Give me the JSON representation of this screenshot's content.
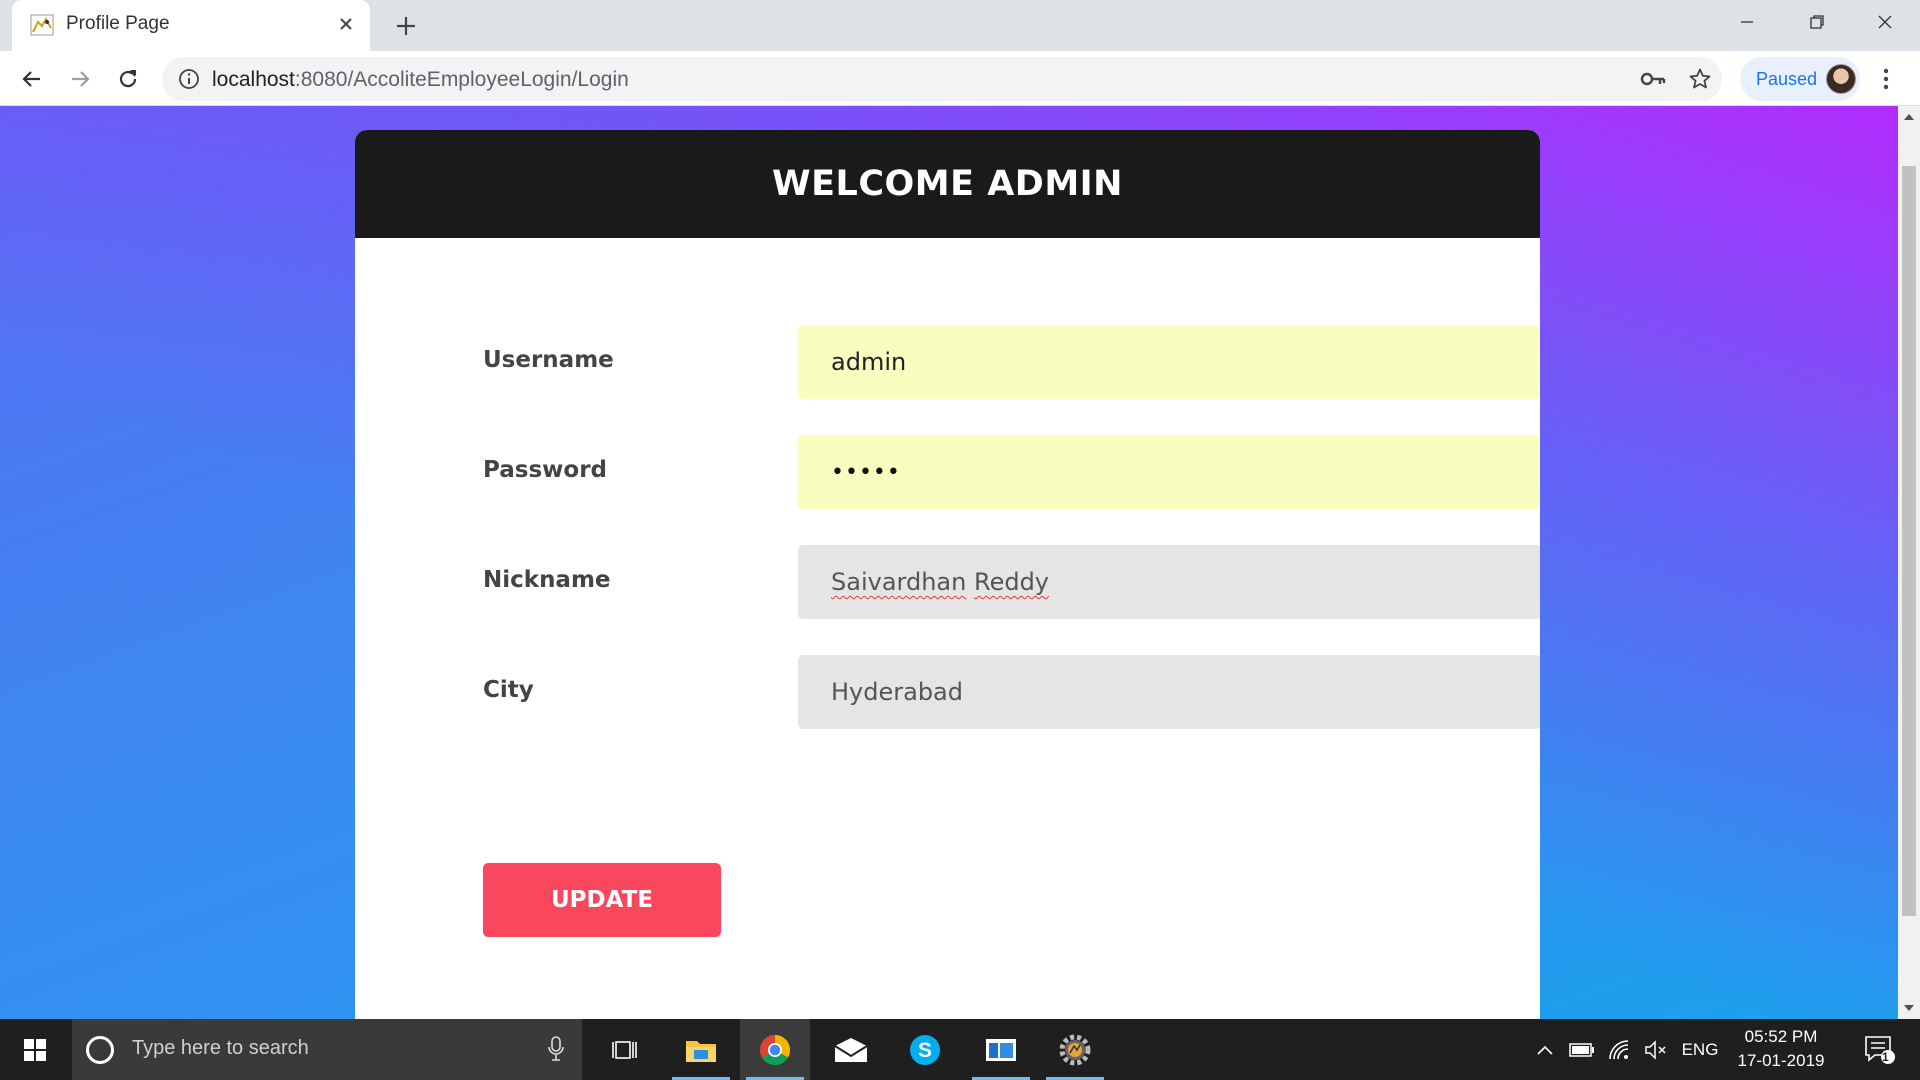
{
  "browser": {
    "tab_title": "Profile Page",
    "url_host": "localhost",
    "url_path": ":8080/AccoliteEmployeeLogin/Login",
    "profile_label": "Paused"
  },
  "page": {
    "title": "WELCOME ADMIN",
    "fields": {
      "username": {
        "label": "Username",
        "value": "admin"
      },
      "password": {
        "label": "Password",
        "value": "•••••"
      },
      "nickname": {
        "label": "Nickname",
        "value_first": "Saivardhan",
        "value_second": "Reddy"
      },
      "city": {
        "label": "City",
        "value": "Hyderabad"
      }
    },
    "update_label": "UPDATE"
  },
  "taskbar": {
    "search_placeholder": "Type here to search",
    "language": "ENG",
    "time": "05:52 PM",
    "date": "17-01-2019",
    "notification_count": "1"
  },
  "colors": {
    "header_bg": "#1a1a1a",
    "button_bg": "#f9475e",
    "autofill_bg": "#f9fdc0",
    "input_bg": "#e5e5e5",
    "gradient_left": "#1ca1ee",
    "gradient_right": "#b928ff"
  }
}
